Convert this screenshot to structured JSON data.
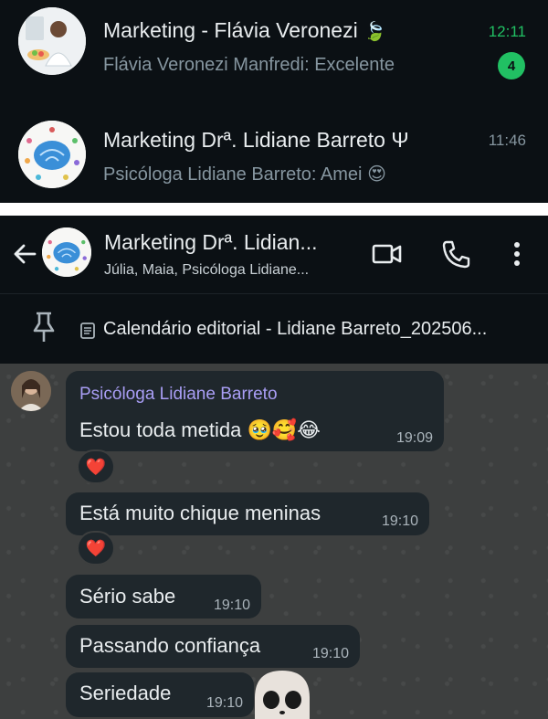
{
  "chat_list": [
    {
      "title": "Marketing - Flávia Veronezi",
      "title_emoji": "🍃",
      "preview": "Flávia Veronezi Manfredi: Excelente",
      "time": "12:11",
      "unread": "4"
    },
    {
      "title": "Marketing Drª. Lidiane Barreto Ψ",
      "preview": "Psicóloga Lidiane Barreto: Amei",
      "preview_emoji": "😍",
      "time": "11:46"
    }
  ],
  "header": {
    "title": "Marketing Drª. Lidian...",
    "subtitle": "Júlia, Maia, Psicóloga Lidiane..."
  },
  "pinned": {
    "text": "Calendário editorial - Lidiane Barreto_202506..."
  },
  "messages": [
    {
      "sender": "Psicóloga Lidiane Barreto",
      "text": "Estou toda metida",
      "emoji": "🥹🥰😂",
      "time": "19:09",
      "reaction": "❤️"
    },
    {
      "text": "Está muito chique meninas",
      "time": "19:10",
      "reaction": "❤️"
    },
    {
      "text": "Sério sabe",
      "time": "19:10"
    },
    {
      "text": "Passando confiança",
      "time": "19:10"
    },
    {
      "text": "Seriedade",
      "time": "19:10"
    }
  ],
  "colors": {
    "accent_green": "#21c063",
    "sender_name": "#a99ef5",
    "bubble": "#1f272c"
  }
}
